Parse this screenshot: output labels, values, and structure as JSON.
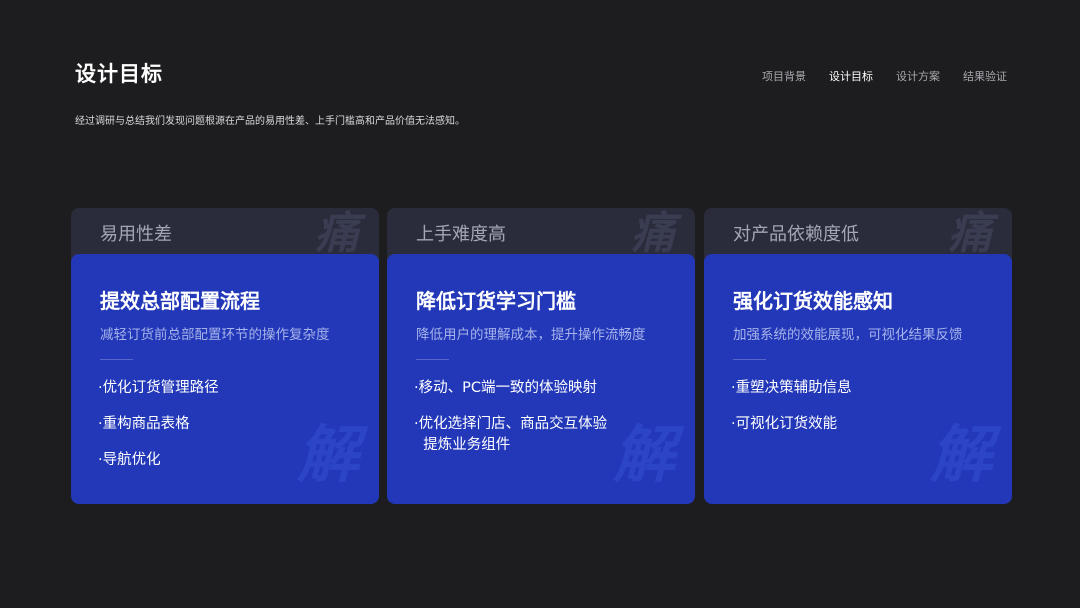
{
  "header": {
    "title": "设计目标",
    "subtitle": "经过调研与总结我们发现问题根源在产品的易用性差、上手门槛高和产品价值无法感知。",
    "nav": [
      "项目背景",
      "设计目标",
      "设计方案",
      "结果验证"
    ],
    "active_nav_index": 1
  },
  "watermarks": {
    "pain": "痛",
    "solution": "解"
  },
  "columns": [
    {
      "pain": "易用性差",
      "title": "提效总部配置流程",
      "desc": "减轻订货前总部配置环节的操作复杂度",
      "items": [
        "·优化订货管理路径",
        "·重构商品表格",
        "·导航优化"
      ]
    },
    {
      "pain": "上手难度高",
      "title": "降低订货学习门槛",
      "desc": "降低用户的理解成本，提升操作流畅度",
      "items": [
        "·移动、PC端一致的体验映射",
        "·优化选择门店、商品交互体验\n  提炼业务组件"
      ]
    },
    {
      "pain": "对产品依赖度低",
      "title": "强化订货效能感知",
      "desc": "加强系统的效能展现，可视化结果反馈",
      "items": [
        "·重塑决策辅助信息",
        "·可视化订货效能"
      ]
    }
  ],
  "colors": {
    "background": "#1d1d1f",
    "card": "#2238b8",
    "pain_header": "#2a2c3c"
  }
}
